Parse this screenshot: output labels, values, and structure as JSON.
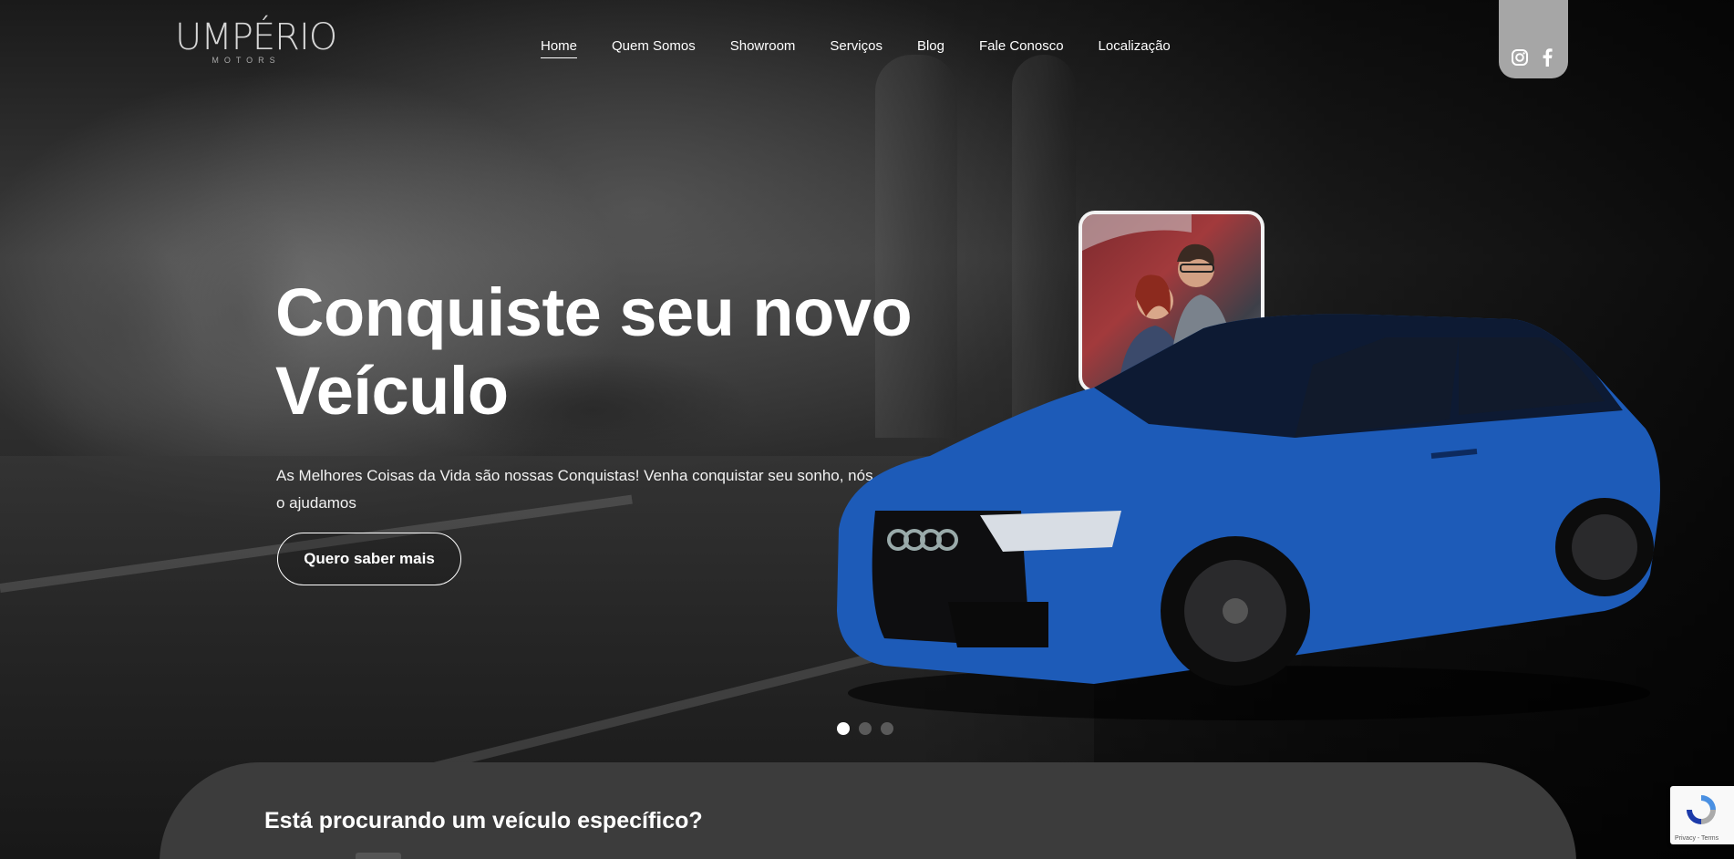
{
  "brand": {
    "logo_word": "UMPÉRIO",
    "logo_sub": "MOTORS"
  },
  "nav": {
    "items": [
      {
        "label": "Home",
        "active": true
      },
      {
        "label": "Quem Somos",
        "active": false
      },
      {
        "label": "Showroom",
        "active": false
      },
      {
        "label": "Serviços",
        "active": false
      },
      {
        "label": "Blog",
        "active": false
      },
      {
        "label": "Fale Conosco",
        "active": false
      },
      {
        "label": "Localização",
        "active": false
      }
    ]
  },
  "social": {
    "icons": [
      "instagram-icon",
      "facebook-icon"
    ],
    "bg_color": "#a6a6a6"
  },
  "hero": {
    "headline_line1": "Conquiste seu novo",
    "headline_line2": "Veículo",
    "subtitle": "As Melhores Coisas da Vida são nossas Conquistas! Venha conquistar seu sonho, nós o ajudamos",
    "cta_label": "Quero saber mais",
    "car_color": "#1d5bb8"
  },
  "carousel": {
    "slide_count": 3,
    "active_index": 0
  },
  "search": {
    "title": "Está procurando um veículo específico?"
  },
  "recaptcha": {
    "legal": "Privacy - Terms"
  }
}
